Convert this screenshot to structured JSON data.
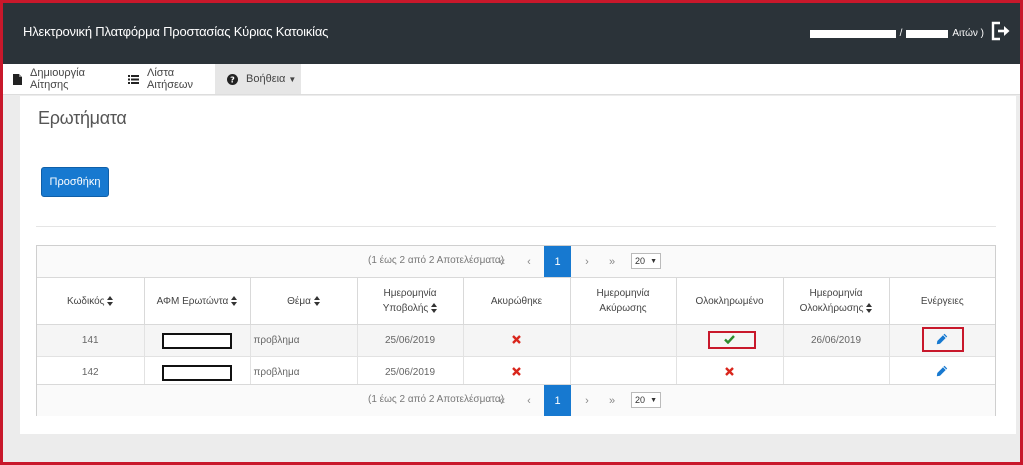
{
  "header": {
    "title": "Ηλεκτρονική Πλατφόρμα Προστασίας Κύριας Κατοικίας",
    "user_separator": "/",
    "user_suffix": "Αιτών )"
  },
  "tabs": [
    {
      "label": "Δημιουργία Αίτησης",
      "icon": "file-icon"
    },
    {
      "label": "Λίστα Αιτήσεων",
      "icon": "list-icon"
    },
    {
      "label": "Βοήθεια",
      "icon": "question-circle-icon",
      "active": true
    }
  ],
  "page": {
    "title": "Ερωτήματα",
    "add_button": "Προσθήκη"
  },
  "pager": {
    "info": "(1 έως 2 από 2 Αποτελέσματα)",
    "first": "«",
    "prev": "‹",
    "current": "1",
    "next": "›",
    "last": "»",
    "rows_per_page": "20"
  },
  "table": {
    "headers": {
      "code": "Κωδικός",
      "afm": "ΑΦΜ Ερωτώντα",
      "subject": "Θέμα",
      "submission_date_line1": "Ημερομηνία",
      "submission_date_line2": "Υποβολής",
      "cancelled": "Ακυρώθηκε",
      "cancel_date_line1": "Ημερομηνία",
      "cancel_date_line2": "Ακύρωσης",
      "completed": "Ολοκληρωμένο",
      "completion_date_line1": "Ημερομηνία",
      "completion_date_line2": "Ολοκλήρωσης",
      "actions": "Ενέργειες"
    },
    "rows": [
      {
        "code": "141",
        "subject": "προβλημα",
        "submission_date": "25/06/2019",
        "cancelled": "no",
        "cancel_date": "",
        "completed": "yes",
        "completion_date": "26/06/2019"
      },
      {
        "code": "142",
        "subject": "προβλημα",
        "submission_date": "25/06/2019",
        "cancelled": "no",
        "cancel_date": "",
        "completed": "no",
        "completion_date": ""
      }
    ]
  },
  "colors": {
    "topbar": "#2b3339",
    "accent_blue": "#1779d0",
    "highlight_red": "#c8182b",
    "cross_red": "#d9261c",
    "check_green": "#2e8b2e"
  }
}
